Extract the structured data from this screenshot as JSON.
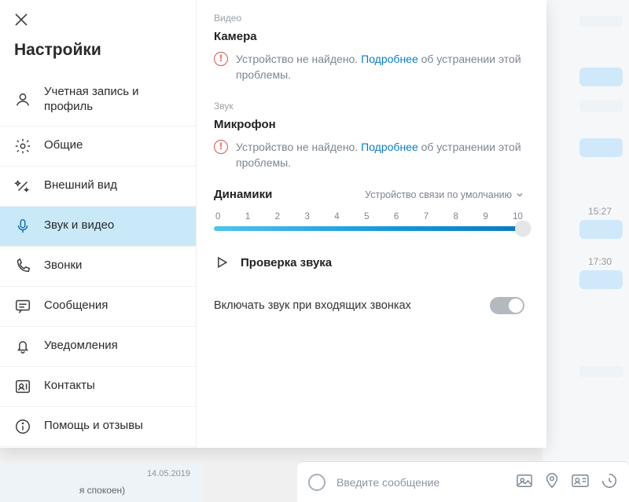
{
  "sidebar": {
    "title": "Настройки",
    "items": [
      {
        "label": "Учетная запись и профиль"
      },
      {
        "label": "Общие"
      },
      {
        "label": "Внешний вид"
      },
      {
        "label": "Звук и видео"
      },
      {
        "label": "Звонки"
      },
      {
        "label": "Сообщения"
      },
      {
        "label": "Уведомления"
      },
      {
        "label": "Контакты"
      },
      {
        "label": "Помощь и отзывы"
      }
    ]
  },
  "content": {
    "video_section": "Видео",
    "camera_title": "Камера",
    "device_not_found": "Устройство не найдено.",
    "learn_more": "Подробнее",
    "problem_tail": "об устранении этой проблемы.",
    "audio_section": "Звук",
    "microphone_title": "Микрофон",
    "speakers_title": "Динамики",
    "speakers_device": "Устройство связи по умолчанию",
    "slider_ticks": [
      "0",
      "1",
      "2",
      "3",
      "4",
      "5",
      "6",
      "7",
      "8",
      "9",
      "10"
    ],
    "slider_value": 10,
    "test_audio": "Проверка звука",
    "unmute_incoming": "Включать звук при входящих звонках",
    "unmute_incoming_on": true
  },
  "background_chat": {
    "times": [
      "15:27",
      "17:30"
    ],
    "date_chip": "14.05.2019",
    "composer_placeholder": "Введите сообщение",
    "left_snippet": "я спокоен)"
  }
}
